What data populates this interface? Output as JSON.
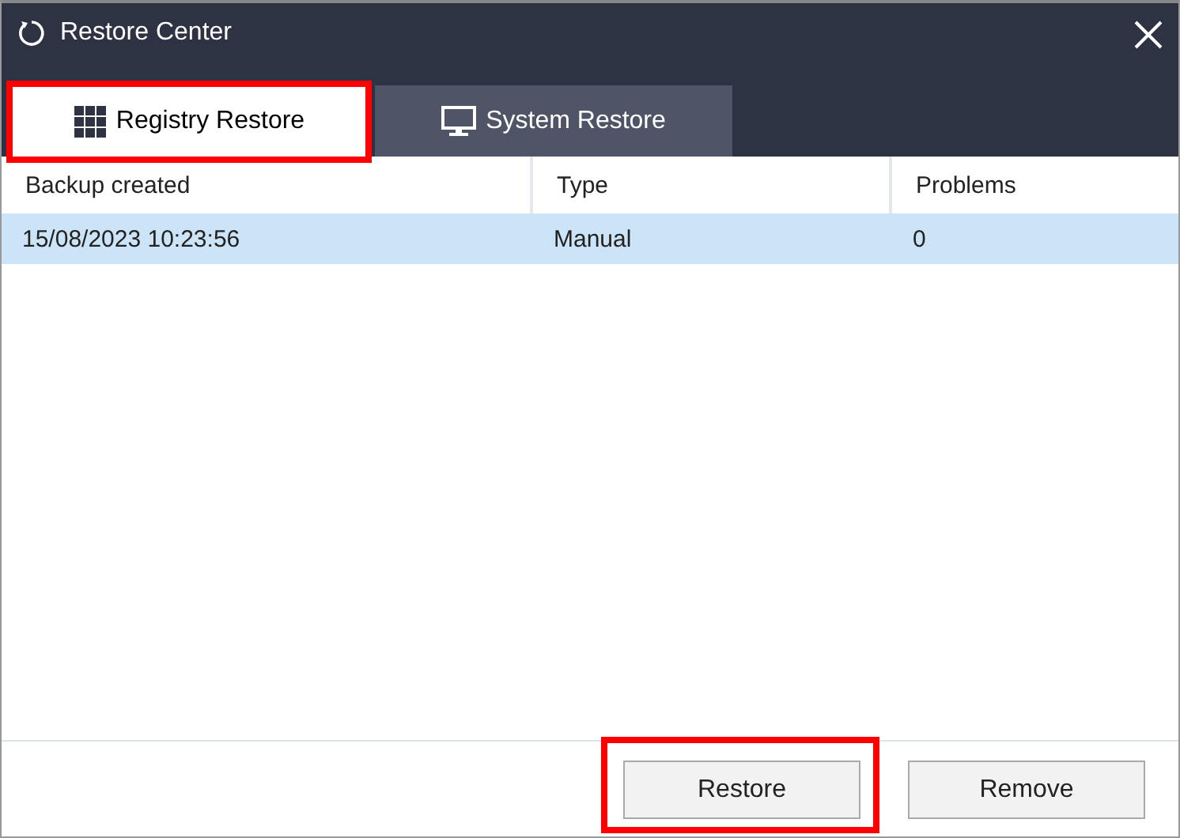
{
  "window": {
    "title": "Restore Center"
  },
  "tabs": [
    {
      "label": "Registry Restore",
      "selected": true,
      "highlighted": true
    },
    {
      "label": "System Restore",
      "selected": false,
      "highlighted": false
    }
  ],
  "table": {
    "columns": [
      "Backup created",
      "Type",
      "Problems"
    ],
    "rows": [
      {
        "cells": [
          "15/08/2023 10:23:56",
          "Manual",
          "0"
        ],
        "selected": true
      }
    ]
  },
  "buttons": [
    {
      "label": "Restore",
      "highlighted": true
    },
    {
      "label": "Remove",
      "highlighted": false
    }
  ]
}
